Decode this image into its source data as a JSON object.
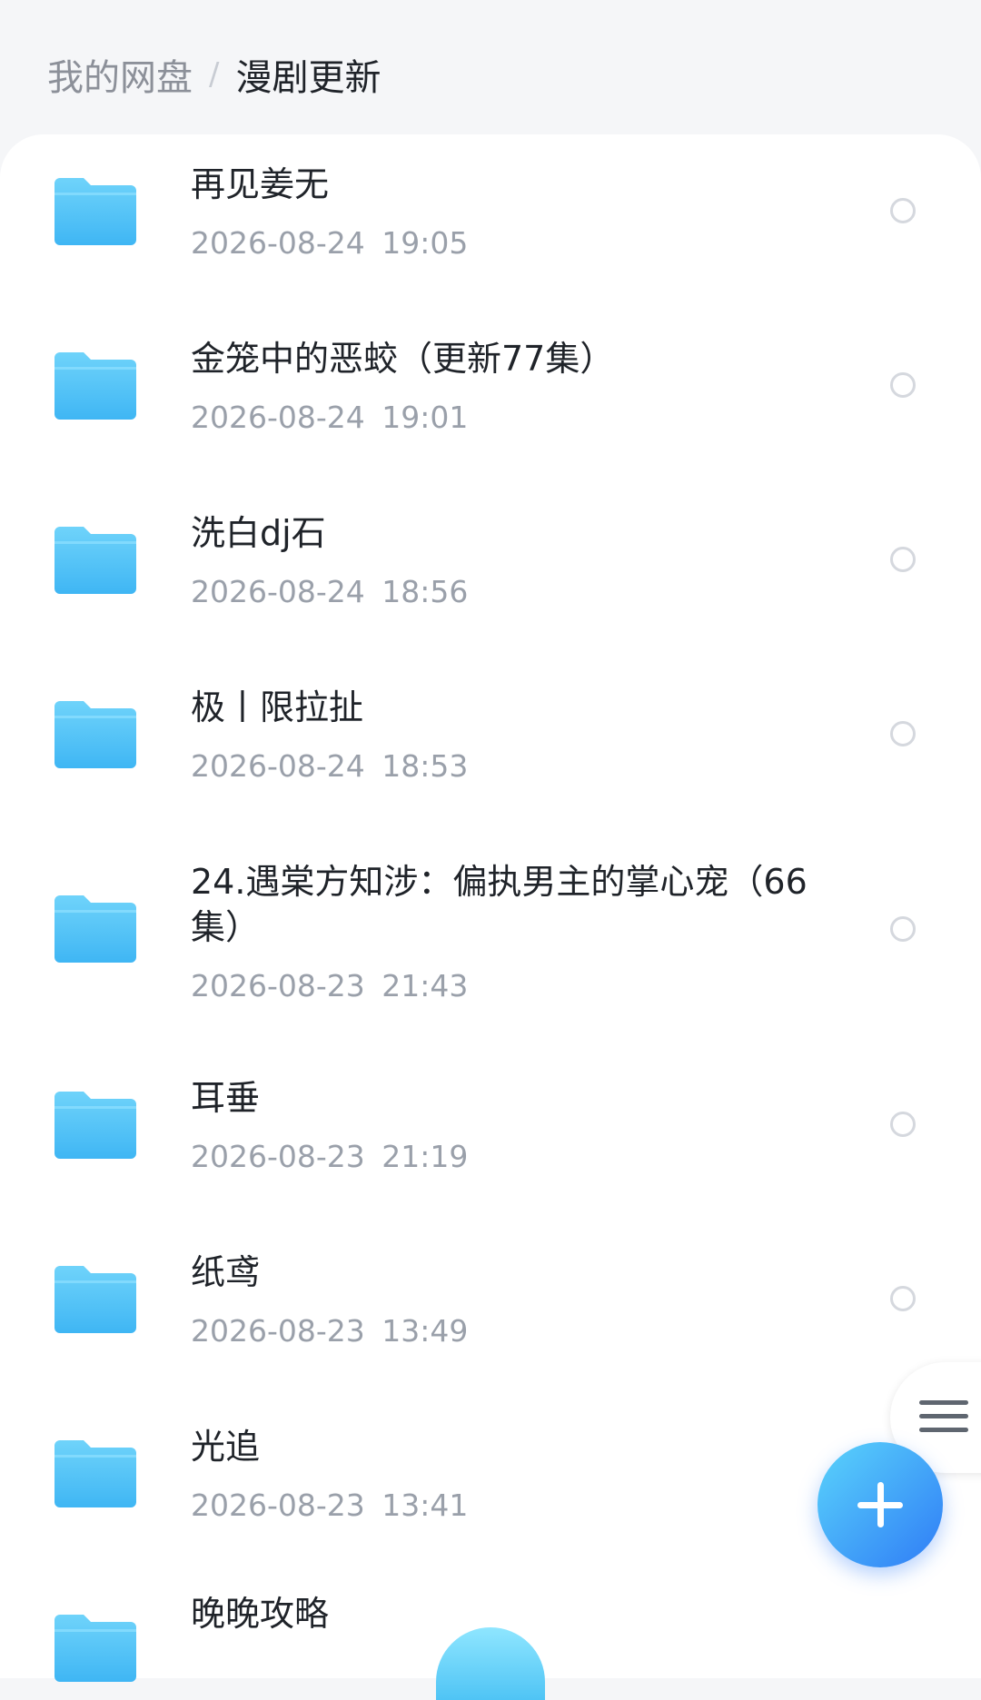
{
  "breadcrumb": {
    "root": "我的网盘",
    "separator": "/",
    "current": "漫剧更新"
  },
  "colors": {
    "folder_top": "#6fd3fa",
    "folder_bottom": "#3fb6f4",
    "fab_start": "#5ad4fb",
    "fab_end": "#2f7cf6"
  },
  "files": [
    {
      "name": "再见姜无",
      "date": "2026-08-24  19:05"
    },
    {
      "name": "金笼中的恶蛟（更新77集）",
      "date": "2026-08-24  19:01"
    },
    {
      "name": "洗白dj石",
      "date": "2026-08-24  18:56"
    },
    {
      "name": "极丨限拉扯",
      "date": "2026-08-24  18:53"
    },
    {
      "name": "24.遇棠方知涉：偏执男主的掌心宠（66集）",
      "date": "2026-08-23  21:43"
    },
    {
      "name": "耳垂",
      "date": "2026-08-23  21:19"
    },
    {
      "name": "纸鸢",
      "date": "2026-08-23  13:49"
    },
    {
      "name": "光追",
      "date": "2026-08-23  13:41"
    },
    {
      "name": "晚晚攻略",
      "date": ""
    }
  ]
}
